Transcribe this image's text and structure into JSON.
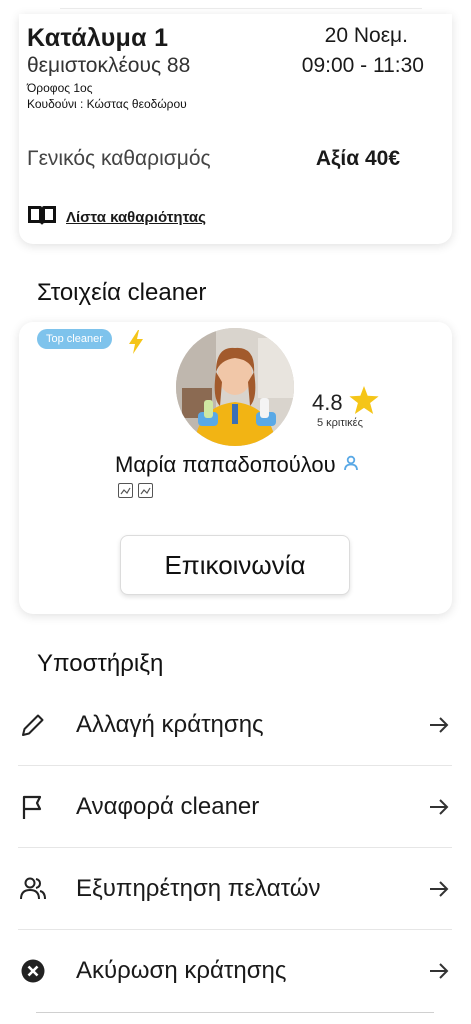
{
  "booking": {
    "title": "Κατάλυμα 1",
    "street": "θεμιστοκλέους 88",
    "floor": "Όροφος 1ος",
    "doorbell": "Κουδούνι : Κώστας θεοδώρου",
    "date": "20 Νοεμ.",
    "time": "09:00 - 11:30",
    "service": "Γενικός καθαρισμός",
    "price": "Αξία 40€",
    "checklist_label": "Λίστα καθαριότητας",
    "checklist_icon": "book-icon"
  },
  "cleaner_section": {
    "title": "Στοιχεία cleaner",
    "badge": "Top cleaner",
    "badge_icon": "lightning-icon",
    "rating": "4.8",
    "rating_icon": "star-icon",
    "reviews": "5 κριτικές",
    "name": "Μαρία παπαδοπούλου",
    "name_icon": "person-icon",
    "contact_label": "Επικοινωνία",
    "colors": {
      "badge": "#7ec3ec",
      "bolt": "#f5c518",
      "star": "#f5c518",
      "person": "#5aa9e6"
    }
  },
  "support": {
    "title": "Υποστήριξη",
    "items": [
      {
        "label": "Αλλαγή κράτησης",
        "icon": "pencil-icon"
      },
      {
        "label": "Αναφορά cleaner",
        "icon": "flag-icon"
      },
      {
        "label": "Εξυπηρέτηση πελατών",
        "icon": "people-icon"
      },
      {
        "label": "Ακύρωση κράτησης",
        "icon": "cancel-circle-icon"
      }
    ],
    "arrow_icon": "arrow-right-icon"
  }
}
